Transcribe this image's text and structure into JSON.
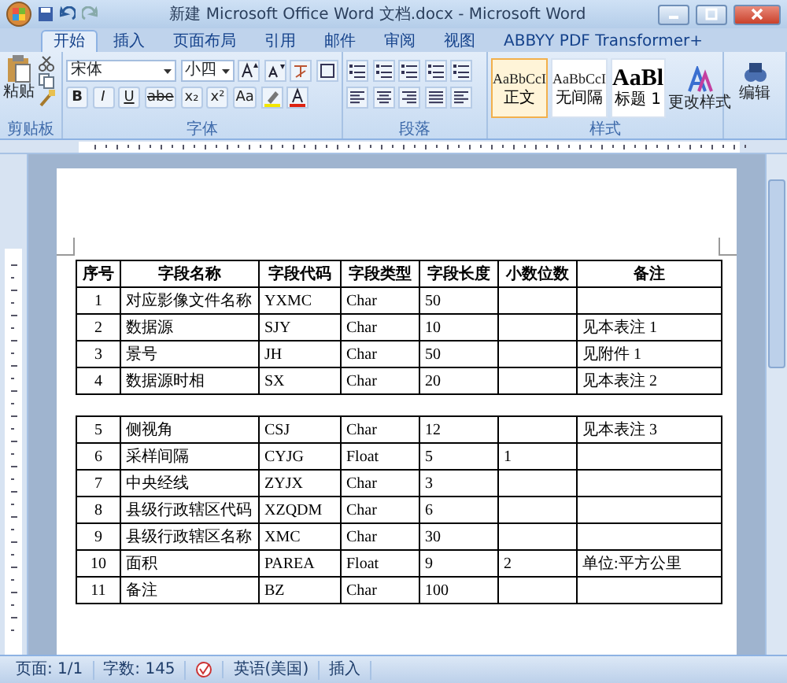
{
  "window": {
    "title": "新建 Microsoft Office Word 文档.docx - Microsoft Word"
  },
  "tabs": [
    {
      "label": "开始",
      "selected": true
    },
    {
      "label": "插入",
      "selected": false
    },
    {
      "label": "页面布局",
      "selected": false
    },
    {
      "label": "引用",
      "selected": false
    },
    {
      "label": "邮件",
      "selected": false
    },
    {
      "label": "审阅",
      "selected": false
    },
    {
      "label": "视图",
      "selected": false
    },
    {
      "label": "ABBYY PDF Transformer+",
      "selected": false
    }
  ],
  "ribbon": {
    "clipboard": {
      "paste_label": "粘贴",
      "group_label": "剪贴板"
    },
    "font": {
      "font_name": "宋体",
      "font_size": "小四",
      "format_buttons": [
        "B",
        "I",
        "U",
        "abe",
        "x₂",
        "x²",
        "Aa"
      ],
      "group_label": "字体"
    },
    "paragraph": {
      "group_label": "段落"
    },
    "styles": {
      "items": [
        {
          "sample": "AaBbCcI",
          "name": "正文",
          "selected": true,
          "kind": "normal"
        },
        {
          "sample": "AaBbCcI",
          "name": "无间隔",
          "selected": false,
          "kind": "normal"
        },
        {
          "sample": "AaBl",
          "name": "标题 1",
          "selected": false,
          "kind": "heading"
        }
      ],
      "change_label": "更改样式",
      "group_label": "样式"
    },
    "editing": {
      "label": "编辑"
    }
  },
  "tables": [
    {
      "columns": [
        "序号",
        "字段名称",
        "字段代码",
        "字段类型",
        "字段长度",
        "小数位数",
        "备注"
      ],
      "rows": [
        [
          "1",
          "对应影像文件名称",
          "YXMC",
          "Char",
          "50",
          null,
          null
        ],
        [
          "2",
          "数据源",
          "SJY",
          "Char",
          "10",
          null,
          "见本表注 1"
        ],
        [
          "3",
          "景号",
          "JH",
          "Char",
          "50",
          null,
          "见附件 1"
        ],
        [
          "4",
          "数据源时相",
          "SX",
          "Char",
          "20",
          null,
          "见本表注 2"
        ]
      ]
    },
    {
      "rows": [
        [
          "5",
          "侧视角",
          "CSJ",
          "Char",
          "12",
          null,
          "见本表注 3"
        ],
        [
          "6",
          "采样间隔",
          "CYJG",
          "Float",
          "5",
          "1",
          null
        ],
        [
          "7",
          "中央经线",
          "ZYJX",
          "Char",
          "3",
          null,
          null
        ],
        [
          "8",
          "县级行政辖区代码",
          "XZQDM",
          "Char",
          "6",
          null,
          null
        ],
        [
          "9",
          "县级行政辖区名称",
          "XMC",
          "Char",
          "30",
          null,
          null
        ],
        [
          "10",
          "面积",
          "PAREA",
          "Float",
          "9",
          "2",
          "单位:平方公里"
        ],
        [
          "11",
          "备注",
          "BZ",
          "Char",
          "100",
          null,
          null
        ]
      ]
    }
  ],
  "status_bar": {
    "page": "页面: 1/1",
    "words": "字数: 145",
    "language": "英语(美国)",
    "mode": "插入"
  }
}
